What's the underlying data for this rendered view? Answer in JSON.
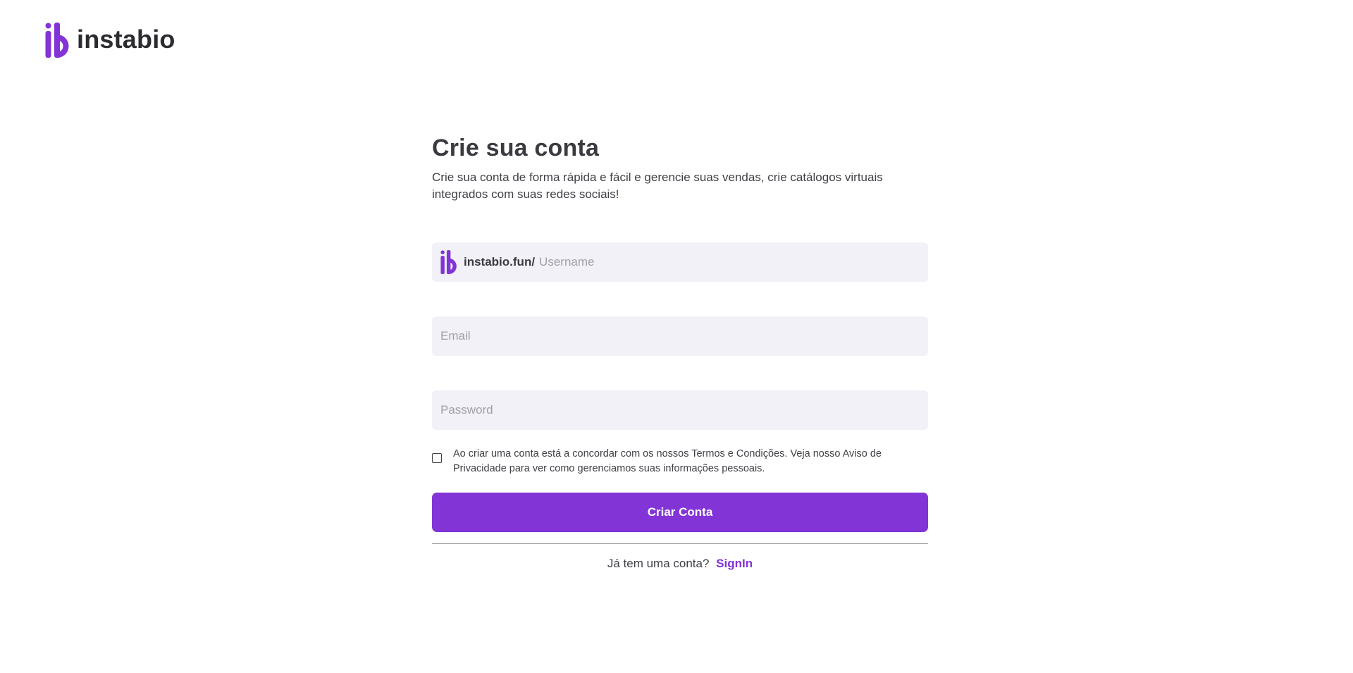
{
  "brand": {
    "name": "instabio",
    "logo_icon": "instabio-ib-logo-icon",
    "accent_color": "#8234d6"
  },
  "page": {
    "title": "Crie sua conta",
    "subtitle": "Crie sua conta de forma rápida e fácil e gerencie suas vendas, crie catálogos virtuais integrados com suas redes sociais!"
  },
  "form": {
    "username": {
      "prefix": "instabio.fun/",
      "placeholder": "Username",
      "value": ""
    },
    "email": {
      "placeholder": "Email",
      "value": ""
    },
    "password": {
      "placeholder": "Password",
      "value": ""
    },
    "terms": {
      "checked": false,
      "text": "Ao criar uma conta está a concordar com os nossos Termos e Condições. Veja nosso Aviso de Privacidade para ver como gerenciamos suas informações pessoais."
    },
    "submit_label": "Criar Conta"
  },
  "footer": {
    "prompt": "Já tem uma conta?",
    "signin_label": "SignIn"
  }
}
